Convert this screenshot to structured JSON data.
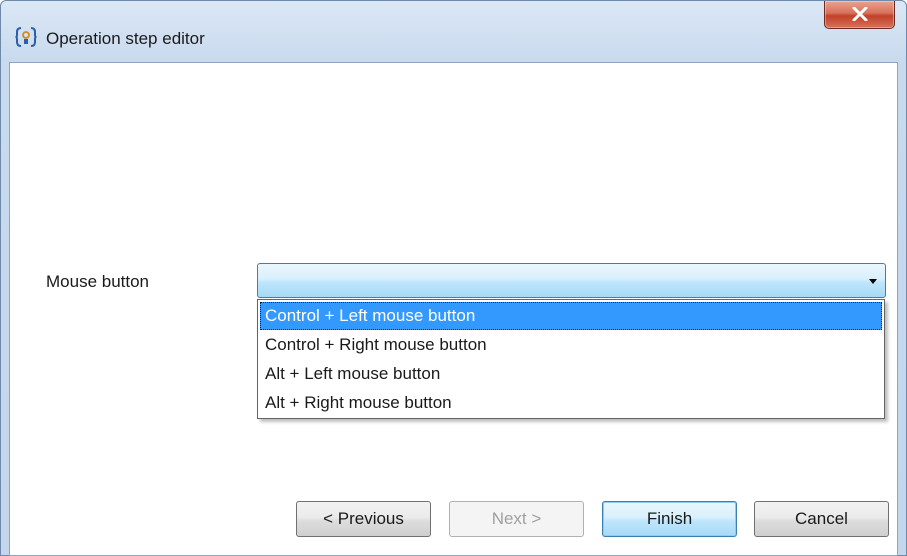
{
  "window": {
    "title": "Operation step editor",
    "icon": "operation-step-icon",
    "close_icon": "close-icon"
  },
  "form": {
    "mouse_button_label": "Mouse button",
    "mouse_button_value": "",
    "dropdown_options": [
      "Control + Left mouse button",
      "Control + Right mouse button",
      "Alt + Left mouse button",
      "Alt + Right mouse button"
    ],
    "highlighted_option": "Control + Left mouse button"
  },
  "footer": {
    "previous_label": "< Previous",
    "next_label": "Next >",
    "finish_label": "Finish",
    "cancel_label": "Cancel"
  },
  "colors": {
    "highlight": "#3399ff",
    "close_button": "#c2412a"
  }
}
